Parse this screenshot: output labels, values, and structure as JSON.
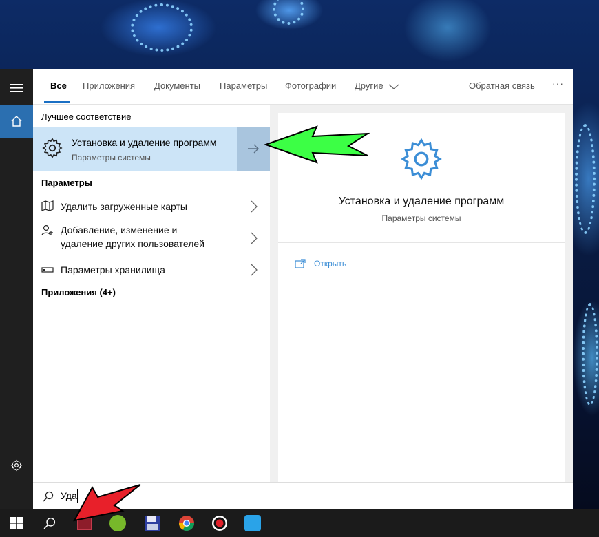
{
  "tabs": [
    {
      "label": "Все"
    },
    {
      "label": "Приложения"
    },
    {
      "label": "Документы"
    },
    {
      "label": "Параметры"
    },
    {
      "label": "Фотографии"
    },
    {
      "label": "Другие"
    }
  ],
  "feedback": "Обратная связь",
  "more": "···",
  "best_match": {
    "heading": "Лучшее соответствие",
    "title": "Установка и удаление программ",
    "subtitle": "Параметры системы"
  },
  "settings_heading": "Параметры",
  "settings_items": [
    {
      "line1": "Удалить загруженные карты",
      "line2": ""
    },
    {
      "line1": "Добавление, изменение и",
      "line2": "удаление других пользователей"
    },
    {
      "line1": "Параметры хранилища",
      "line2": ""
    }
  ],
  "apps_heading": "Приложения (4+)",
  "preview": {
    "title": "Установка и удаление программ",
    "subtitle": "Параметры системы",
    "open_label": "Открыть"
  },
  "search": {
    "query": "Уда"
  },
  "colors": {
    "accent": "#1a6fc4",
    "highlight": "#cce4f7",
    "link": "#3c8ed6"
  }
}
